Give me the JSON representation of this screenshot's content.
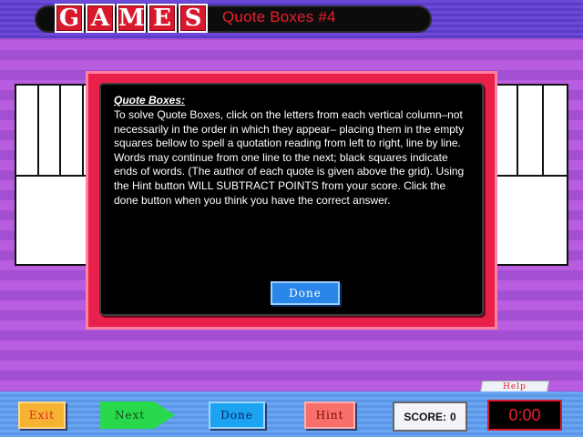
{
  "header": {
    "logo_letters": [
      "G",
      "A",
      "M",
      "E",
      "S"
    ],
    "title": "Quote Boxes #4"
  },
  "modal": {
    "heading": "Quote Boxes:",
    "body": "To solve Quote Boxes, click on the letters from each vertical column–not necessarily in the order in which they appear– placing them in the empty squares bellow to spell a quotation reading from left to right, line by line. Words may continue from one line to the next; black squares indicate ends of words. (The author of each quote is given above the grid).  Using the Hint button WILL SUBTRACT POINTS from your score.  Click the done button when you think you have the correct answer.",
    "done_label": "Done"
  },
  "toolbar": {
    "help_label": "Help",
    "exit_label": "Exit",
    "next_label": "Next",
    "done_label": "Done",
    "hint_label": "Hint",
    "score_label": "SCORE:",
    "score_value": "0",
    "timer": "0:00"
  },
  "colors": {
    "accent_red": "#e8202c",
    "modal_frame": "#e8204a",
    "done_blue": "#2a86e8",
    "exit_orange": "#f4b431",
    "next_green": "#28d94b",
    "hint_salmon": "#f86f6b"
  },
  "icons": {
    "next_arrow": "arrow-right-icon"
  }
}
